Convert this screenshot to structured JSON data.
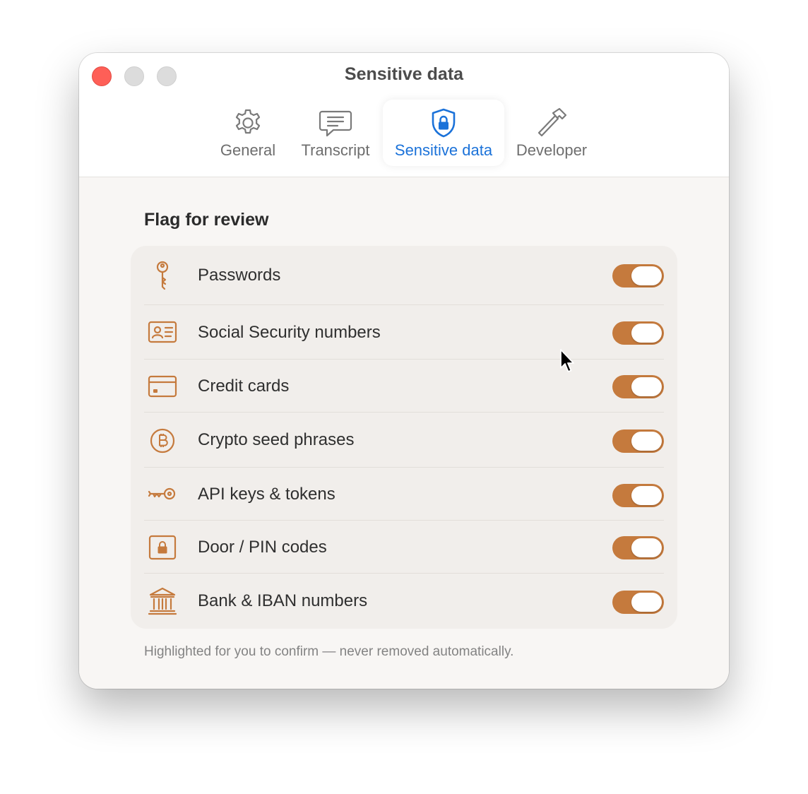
{
  "window": {
    "title": "Sensitive data"
  },
  "tabs": [
    {
      "label": "General",
      "icon": "gear-icon"
    },
    {
      "label": "Transcript",
      "icon": "chat-bubble-icon"
    },
    {
      "label": "Sensitive data",
      "icon": "lock-shield-icon",
      "active": true
    },
    {
      "label": "Developer",
      "icon": "hammer-icon"
    }
  ],
  "section": {
    "title": "Flag for review"
  },
  "items": [
    {
      "label": "Passwords",
      "icon": "key-icon",
      "enabled": true
    },
    {
      "label": "Social Security numbers",
      "icon": "id-card-icon",
      "enabled": true
    },
    {
      "label": "Credit cards",
      "icon": "credit-card-icon",
      "enabled": true
    },
    {
      "label": "Crypto seed phrases",
      "icon": "bitcoin-icon",
      "enabled": true
    },
    {
      "label": "API keys & tokens",
      "icon": "api-key-icon",
      "enabled": true
    },
    {
      "label": "Door / PIN codes",
      "icon": "door-lock-icon",
      "enabled": true
    },
    {
      "label": "Bank & IBAN numbers",
      "icon": "bank-icon",
      "enabled": true
    }
  ],
  "footnote": "Highlighted for you to confirm — never removed automatically.",
  "colors": {
    "accent": "#c57a3d",
    "active_tab": "#1b72d9",
    "close": "#fe5f57"
  }
}
